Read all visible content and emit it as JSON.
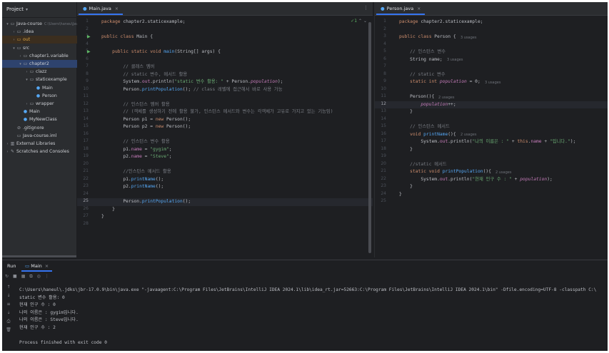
{
  "project": {
    "title": "Project",
    "tree": [
      {
        "label": "Java-course",
        "sub": "C:\\Users\\haneu\\Jav",
        "icon": "▭",
        "arrow": "▾",
        "indent": 0
      },
      {
        "label": ".idea",
        "icon": "▭",
        "arrow": "›",
        "indent": 1
      },
      {
        "label": "out",
        "icon": "▭",
        "arrow": "›",
        "indent": 1
      },
      {
        "label": "src",
        "icon": "▭",
        "arrow": "▾",
        "indent": 1
      },
      {
        "label": "chapter1.variable",
        "icon": "▭",
        "arrow": "›",
        "indent": 2
      },
      {
        "label": "chapter2",
        "icon": "▭",
        "arrow": "▾",
        "indent": 2
      },
      {
        "label": "clazz",
        "icon": "▭",
        "arrow": "›",
        "indent": 3
      },
      {
        "label": "staticexample",
        "icon": "▭",
        "arrow": "▾",
        "indent": 3
      },
      {
        "label": "Main",
        "icon": "●",
        "arrow": "",
        "indent": 4
      },
      {
        "label": "Person",
        "icon": "●",
        "arrow": "",
        "indent": 4
      },
      {
        "label": "wrapper",
        "icon": "▭",
        "arrow": "›",
        "indent": 3
      },
      {
        "label": "Main",
        "icon": "●",
        "arrow": "",
        "indent": 2
      },
      {
        "label": "MyNewClass",
        "icon": "●",
        "arrow": "",
        "indent": 2
      },
      {
        "label": ".gitignore",
        "icon": "⊘",
        "arrow": "",
        "indent": 1
      },
      {
        "label": "Java-course.iml",
        "icon": "▭",
        "arrow": "",
        "indent": 1
      },
      {
        "label": "External Libraries",
        "icon": "▥",
        "arrow": "›",
        "indent": 0
      },
      {
        "label": "Scratches and Consoles",
        "icon": "✎",
        "arrow": "›",
        "indent": 0
      }
    ]
  },
  "left_editor": {
    "tab": "Main.java",
    "inspection": "✓1",
    "current_line": 25,
    "lines": [
      "package chapter2.staticexample;",
      "",
      "public class Main {",
      "",
      "    public static void main(String[] args) {",
      "",
      "        // 클래스 멤버",
      "        // static 변수, 메서드 활용",
      "        System.out.println(\"static 변수 활용: \" + Person.population);",
      "        Person.printPopulation(); // class 레벨에 접근해서 바로 사용 가능",
      "",
      "        // 인스턴스 멤버 활용",
      "        // (객체를 생성하기 전에 활용 불가, 인스턴스 메서드와 변수는 각객체가 고유로 가지고 있는 기능임)",
      "        Person p1 = new Person();",
      "        Person p2 = new Person();",
      "",
      "        // 인스턴스 변수 활용",
      "        p1.name = \"gygim\";",
      "        p2.name = \"Steve\";",
      "",
      "        //인스턴스 메서드 활용",
      "        p1.printName();",
      "        p2.printName();",
      "",
      "        Person.printPopulation();",
      "    }",
      "}",
      ""
    ]
  },
  "right_editor": {
    "tab": "Person.java",
    "current_line": 12,
    "lines": [
      "package chapter2.staticexample;",
      "",
      "public class Person {",
      "",
      "    // 인스턴스 변수",
      "    String name;",
      "",
      "    // static 변수",
      "    static int population = 0;",
      "",
      "    Person(){",
      "        population++;",
      "    }",
      "",
      "    // 인스턴스 메서드",
      "    void printName(){",
      "        System.out.println(\"나의 이름은 : \" + this.name + \"입니다.\");",
      "    }",
      "",
      "    //static 메서드",
      "    static void printPopulation(){",
      "        System.out.println(\"현재 인구 수 : \" + population);",
      "    }",
      "}",
      ""
    ],
    "hints": {
      "3": "3 usages",
      "6": "3 usages",
      "9": "3 usages",
      "11": "2 usages",
      "16": "2 usages",
      "21": "2 usages"
    }
  },
  "run": {
    "title": "Run",
    "tab": "Main",
    "output": [
      "C:\\Users\\haneul\\.jdks\\jbr-17.0.9\\bin\\java.exe \"-javaagent:C:\\Program Files\\JetBrains\\IntelliJ IDEA 2024.1\\lib\\idea_rt.jar=52663:C:\\Program Files\\JetBrains\\IntelliJ IDEA 2024.1\\bin\" -Dfile.encoding=UTF-8 -classpath C:\\",
      "static 변수 활용: 0",
      "현재 인구 수 : 0",
      "나의 이름은 : gygim입니다.",
      "나의 이름은 : Steve입니다.",
      "현재 인구 수 : 2",
      "",
      "Process finished with exit code 0"
    ]
  }
}
